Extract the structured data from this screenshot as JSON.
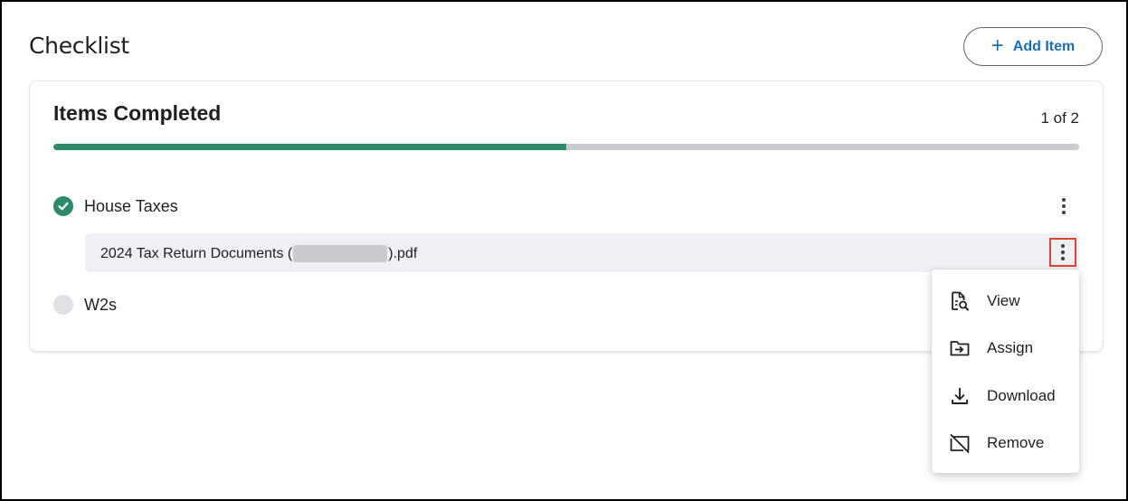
{
  "page": {
    "title": "Checklist"
  },
  "toolbar": {
    "add_label": "Add Item",
    "add_icon": "plus-icon"
  },
  "card": {
    "title": "Items Completed",
    "count": "1 of 2",
    "progress_fraction": 0.5,
    "accent_color": "#2e8b6a"
  },
  "items": [
    {
      "label": "House Taxes",
      "status": "completed",
      "document": {
        "name_prefix": "2024 Tax Return Documents (",
        "name_suffix": ").pdf"
      }
    },
    {
      "label": "W2s",
      "status": "incomplete"
    }
  ],
  "menu": {
    "items": [
      {
        "label": "View",
        "icon": "view-document-icon"
      },
      {
        "label": "Assign",
        "icon": "assign-folder-icon"
      },
      {
        "label": "Download",
        "icon": "download-icon"
      },
      {
        "label": "Remove",
        "icon": "remove-icon"
      }
    ]
  }
}
